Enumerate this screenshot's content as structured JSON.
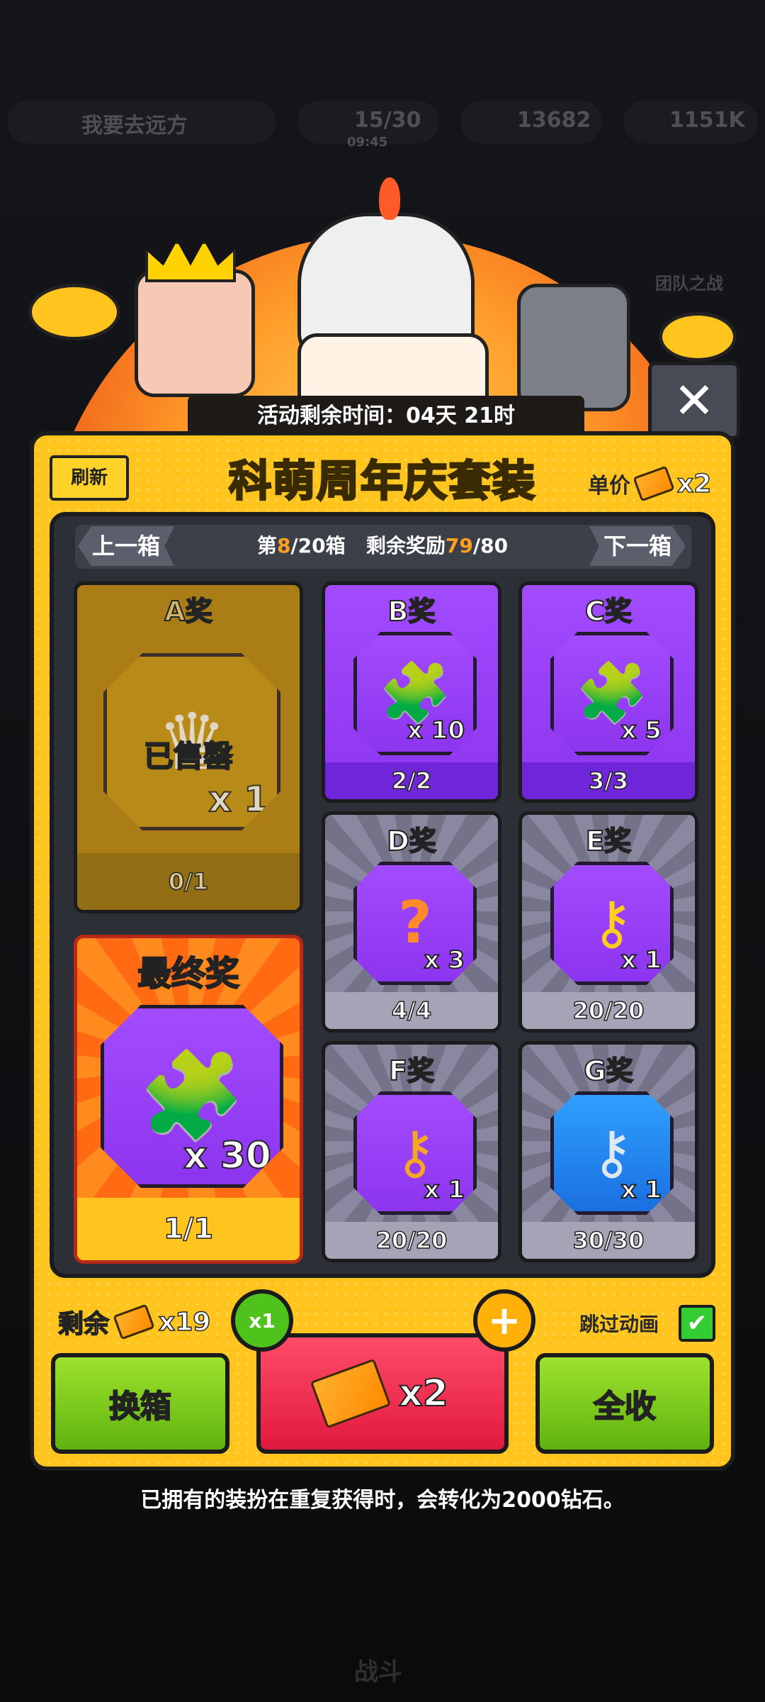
{
  "background": {
    "player_name": "我要去远方",
    "stamina": "15/30",
    "stamina_timer": "09:45",
    "coins": "13682",
    "gems": "1151K",
    "side_label": "团队之战",
    "bottom_label": "战斗"
  },
  "event": {
    "time_left_label": "活动剩余时间：04天 21时",
    "close_icon": "close-icon"
  },
  "panel": {
    "refresh_label": "刷新",
    "title": "科萌周年庆套装",
    "unit_price_label": "单价",
    "unit_price_value": "x2"
  },
  "nav": {
    "prev_label": "上一箱",
    "next_label": "下一箱",
    "box_prefix": "第",
    "box_current": "8",
    "box_suffix": "/20箱",
    "reward_prefix": "剩余奖励",
    "reward_current": "79",
    "reward_suffix": "/80"
  },
  "prizes": {
    "a": {
      "name": "A奖",
      "qty": "x 1",
      "count": "0/1",
      "sold_out": "已售罄",
      "icon": "crown-puzzle-icon"
    },
    "b": {
      "name": "B奖",
      "qty": "x 10",
      "count": "2/2",
      "icon": "puzzle-piece-icon"
    },
    "c": {
      "name": "C奖",
      "qty": "x 5",
      "count": "3/3",
      "icon": "puzzle-piece-icon"
    },
    "d": {
      "name": "D奖",
      "qty": "x 3",
      "count": "4/4",
      "icon": "mystery-puzzle-icon"
    },
    "e": {
      "name": "E奖",
      "qty": "x 1",
      "count": "20/20",
      "icon": "gold-key-icon"
    },
    "f": {
      "name": "F奖",
      "qty": "x 1",
      "count": "20/20",
      "icon": "bronze-key-icon"
    },
    "g": {
      "name": "G奖",
      "qty": "x 1",
      "count": "30/30",
      "icon": "silver-key-icon"
    },
    "final": {
      "name": "最终奖",
      "qty": "x 30",
      "count": "1/1",
      "icon": "puzzle-piece-icon"
    }
  },
  "controls": {
    "remain_label": "剩余",
    "remain_value": "x19",
    "skip_label": "跳过动画",
    "skip_checked": "✔",
    "multiplier": "x1",
    "plus": "+",
    "switch_label": "换箱",
    "draw_cost": "x2",
    "collect_label": "全收"
  },
  "footnote": "已拥有的装扮在重复获得时，会转化为2000钻石。",
  "colors": {
    "accent_gold": "#ffc51e",
    "prize_purple": "#a24bff",
    "draw_red": "#e0193e",
    "action_green": "#6ac21a"
  }
}
